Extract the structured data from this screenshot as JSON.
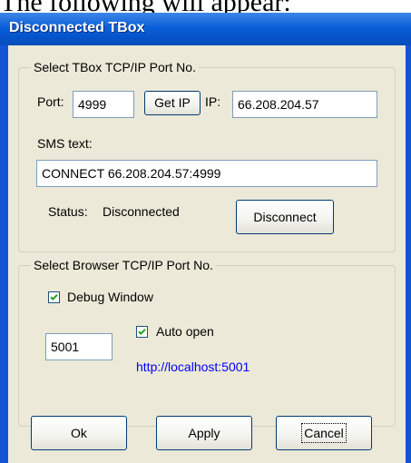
{
  "caption": "The following will appear:",
  "window": {
    "title": "Disconnected TBox"
  },
  "tbox_group": {
    "label": "Select TBox TCP/IP Port No.",
    "port_label": "Port:",
    "port_value": "4999",
    "get_ip_label": "Get IP",
    "ip_label": "IP:",
    "ip_value": "66.208.204.57",
    "sms_label": "SMS text:",
    "sms_value": "CONNECT 66.208.204.57:4999",
    "status_label": "Status:",
    "status_value": "Disconnected",
    "disconnect_label": "Disconnect"
  },
  "browser_group": {
    "label": "Select Browser TCP/IP Port No.",
    "debug_window_label": "Debug Window",
    "debug_window_checked": true,
    "port_value": "5001",
    "auto_open_label": "Auto open",
    "auto_open_checked": true,
    "url": "http://localhost:5001"
  },
  "footer": {
    "ok_label": "Ok",
    "apply_label": "Apply",
    "cancel_label": "Cancel"
  }
}
